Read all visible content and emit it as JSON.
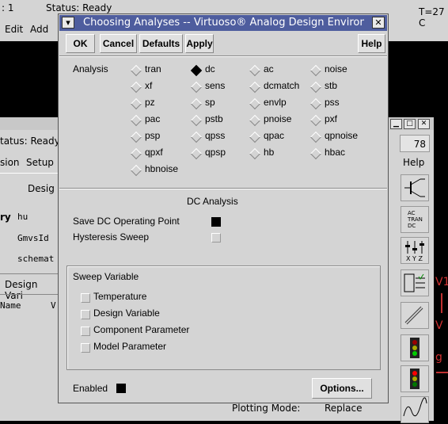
{
  "background_window": {
    "left_fragment": ": 1",
    "status": "Status: Ready",
    "temp": "T=27 C",
    "menu_edit": "Edit",
    "menu_add": "Add"
  },
  "ade_window": {
    "status": "tatus: Ready",
    "menu_session": "sion",
    "menu_setup": "Setup",
    "menu_help": "Help",
    "counter": "78",
    "design_label": "Desig",
    "lib_label": "ry",
    "lib_value": "hu",
    "cell_value": "GmvsId",
    "view_value": "schemat",
    "design_vars": "Design Vari",
    "col_name": "Name",
    "col_v": "V",
    "plotting_mode": "Plotting Mode:",
    "replace": "Replace",
    "toolbar_text_ac": "AC",
    "toolbar_text_tran": "TRAN",
    "toolbar_text_dc": "DC",
    "toolbar_xyz": "X Y Z"
  },
  "dialog": {
    "title": "Choosing Analyses -- Virtuoso® Analog Design Environn",
    "buttons": {
      "ok": "OK",
      "cancel": "Cancel",
      "defaults": "Defaults",
      "apply": "Apply",
      "help": "Help"
    },
    "analysis_label": "Analysis",
    "analyses": [
      [
        "tran",
        "dc",
        "ac",
        "noise"
      ],
      [
        "xf",
        "sens",
        "dcmatch",
        "stb"
      ],
      [
        "pz",
        "sp",
        "envlp",
        "pss"
      ],
      [
        "pac",
        "pstb",
        "pnoise",
        "pxf"
      ],
      [
        "psp",
        "qpss",
        "qpac",
        "qpnoise"
      ],
      [
        "qpxf",
        "qpsp",
        "hb",
        "hbac"
      ],
      [
        "hbnoise"
      ]
    ],
    "selected_analysis": "dc",
    "section_title": "DC Analysis",
    "save_dc_op": "Save DC Operating Point",
    "save_dc_op_checked": true,
    "hysteresis": "Hysteresis Sweep",
    "hysteresis_checked": false,
    "sweep_variable_title": "Sweep Variable",
    "sweep_options": [
      "Temperature",
      "Design Variable",
      "Component Parameter",
      "Model Parameter"
    ],
    "enabled_label": "Enabled",
    "enabled_checked": true,
    "options_button": "Options..."
  }
}
